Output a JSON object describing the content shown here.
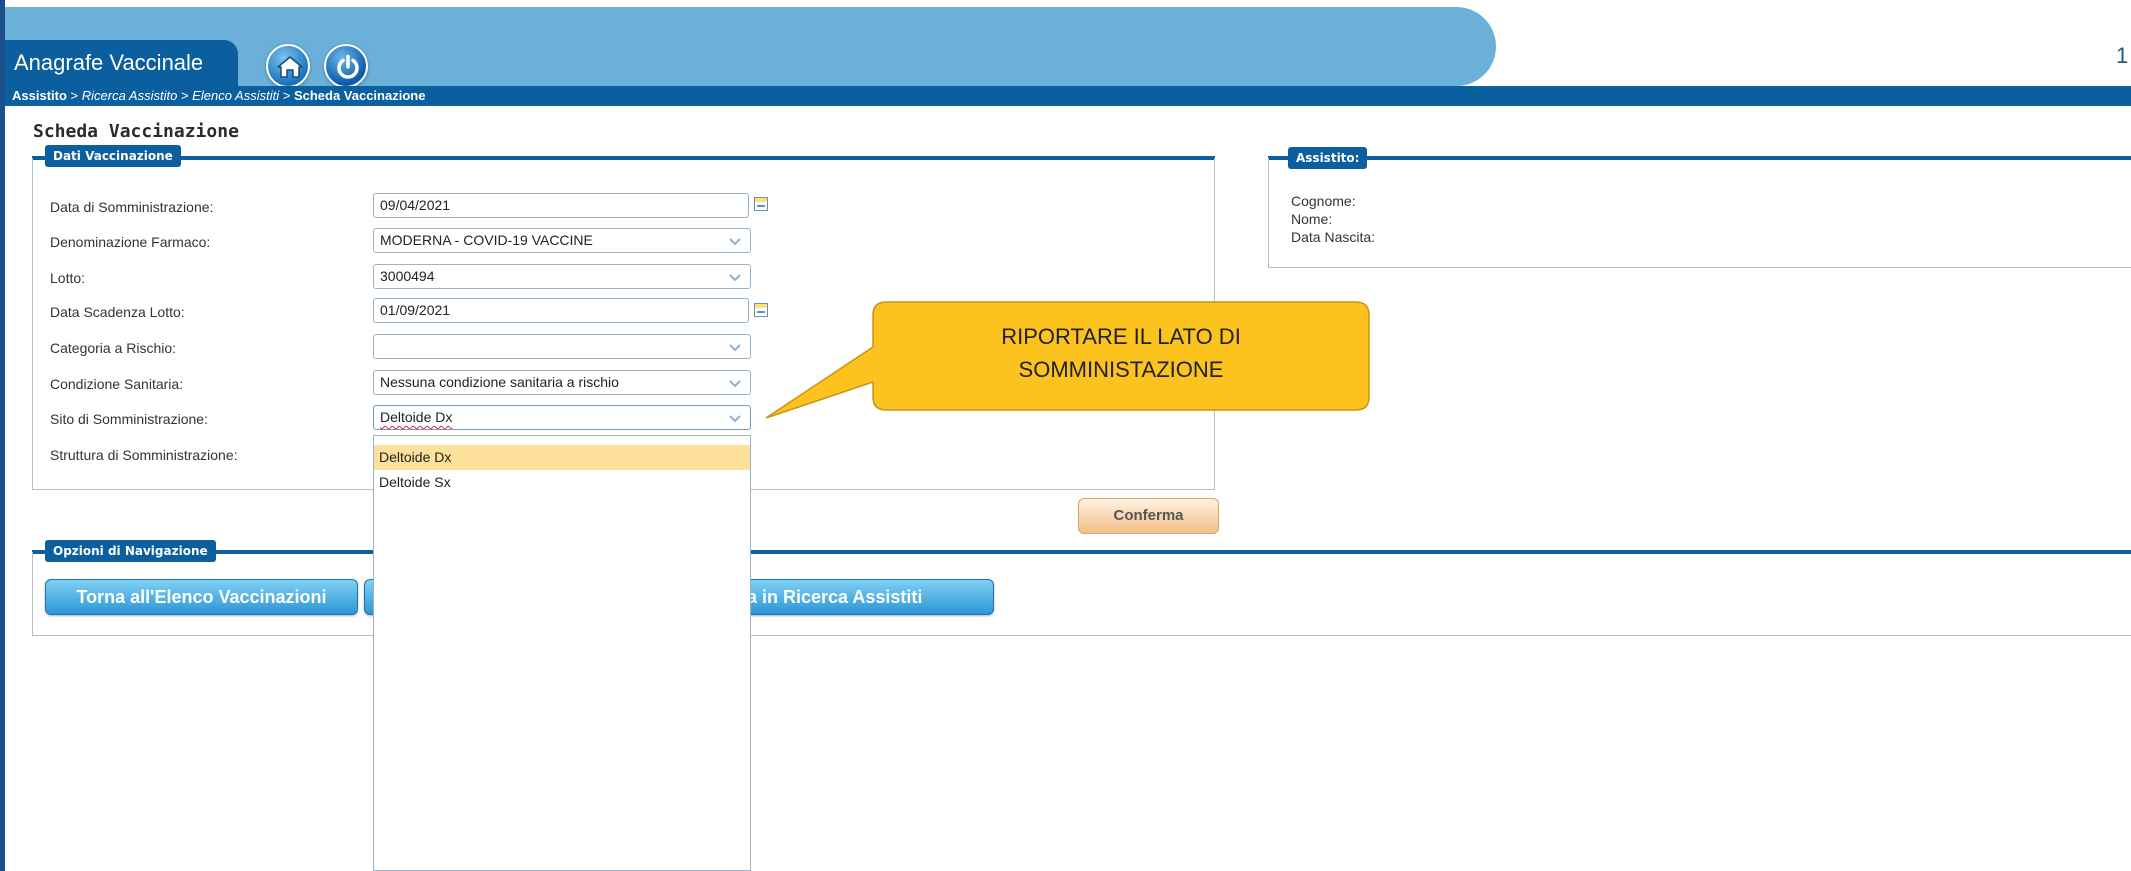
{
  "header": {
    "app_title": "Anagrafe Vaccinale",
    "corner_text": "1",
    "home_icon": "home-icon",
    "power_icon": "power-icon"
  },
  "breadcrumb": {
    "item1": "Assistito",
    "sep": " > ",
    "item2": "Ricerca Assistito",
    "item3": "Elenco Assistiti",
    "item4": "Scheda Vaccinazione"
  },
  "page": {
    "title": "Scheda Vaccinazione"
  },
  "dati_vaccinazione": {
    "legend": "Dati Vaccinazione",
    "fields": [
      {
        "label": "Data di Somministrazione:",
        "value": "09/04/2021",
        "type": "date"
      },
      {
        "label": "Denominazione Farmaco:",
        "value": "MODERNA - COVID-19 VACCINE",
        "type": "select"
      },
      {
        "label": "Lotto:",
        "value": "3000494",
        "type": "select"
      },
      {
        "label": "Data Scadenza Lotto:",
        "value": "01/09/2021",
        "type": "date"
      },
      {
        "label": "Categoria a Rischio:",
        "value": "",
        "type": "select"
      },
      {
        "label": "Condizione Sanitaria:",
        "value": "Nessuna condizione sanitaria a rischio",
        "type": "select"
      },
      {
        "label": "Sito di Somministrazione:",
        "value": "Deltoide Dx",
        "type": "select"
      },
      {
        "label": "Struttura di Somministrazione:",
        "value": "",
        "type": "none"
      }
    ],
    "dropdown_options": [
      "Deltoide Dx",
      "Deltoide Sx"
    ],
    "dropdown_selected": "Deltoide Dx"
  },
  "assistito": {
    "legend": "Assistito:",
    "labels": [
      "Cognome:",
      "Nome:",
      "Data Nascita:"
    ]
  },
  "actions": {
    "conferma": "Conferma"
  },
  "navigazione": {
    "legend": "Opzioni di Navigazione",
    "btn_elenco": "Torna all'Elenco Vaccinazioni",
    "btn_ricerca": "Torna in Ricerca Assistiti",
    "btn_ricerca_visible": "na in Ricerca Assistiti"
  },
  "callout": {
    "text_line1": "RIPORTARE IL LATO DI",
    "text_line2": "SOMMINISTAZIONE"
  },
  "colors": {
    "header_band": "#6ab0d8",
    "brand_blue": "#0b5f9e",
    "callout_fill": "#fcc31e",
    "dropdown_highlight": "#fde09a"
  }
}
